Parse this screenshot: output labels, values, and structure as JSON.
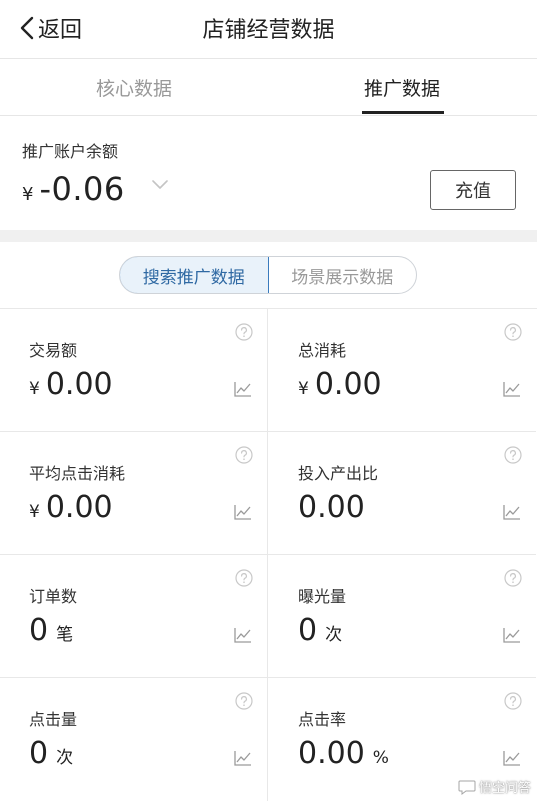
{
  "nav": {
    "back_label": "返回",
    "title": "店铺经营数据"
  },
  "tabs": [
    {
      "label": "核心数据",
      "active": false
    },
    {
      "label": "推广数据",
      "active": true
    }
  ],
  "balance": {
    "label": "推广账户余额",
    "currency": "¥",
    "amount": "-0.06",
    "recharge_label": "充值"
  },
  "segment": {
    "options": [
      {
        "label": "搜索推广数据",
        "selected": true
      },
      {
        "label": "场景展示数据",
        "selected": false
      }
    ]
  },
  "metrics": [
    {
      "label": "交易额",
      "currency": "¥",
      "value": "0.00",
      "unit": ""
    },
    {
      "label": "总消耗",
      "currency": "¥",
      "value": "0.00",
      "unit": ""
    },
    {
      "label": "平均点击消耗",
      "currency": "¥",
      "value": "0.00",
      "unit": ""
    },
    {
      "label": "投入产出比",
      "currency": "",
      "value": "0.00",
      "unit": ""
    },
    {
      "label": "订单数",
      "currency": "",
      "value": "0",
      "unit": "笔"
    },
    {
      "label": "曝光量",
      "currency": "",
      "value": "0",
      "unit": "次"
    },
    {
      "label": "点击量",
      "currency": "",
      "value": "0",
      "unit": "次"
    },
    {
      "label": "点击率",
      "currency": "",
      "value": "0.00",
      "unit": "%"
    }
  ],
  "watermark": {
    "text": "悟空问答",
    "icon": "chat-bubble-icon"
  },
  "colors": {
    "accent_blue": "#2f69a3",
    "segment_bg": "#e9f2fa",
    "separator": "#f0f0f0",
    "muted_text": "#999999"
  }
}
